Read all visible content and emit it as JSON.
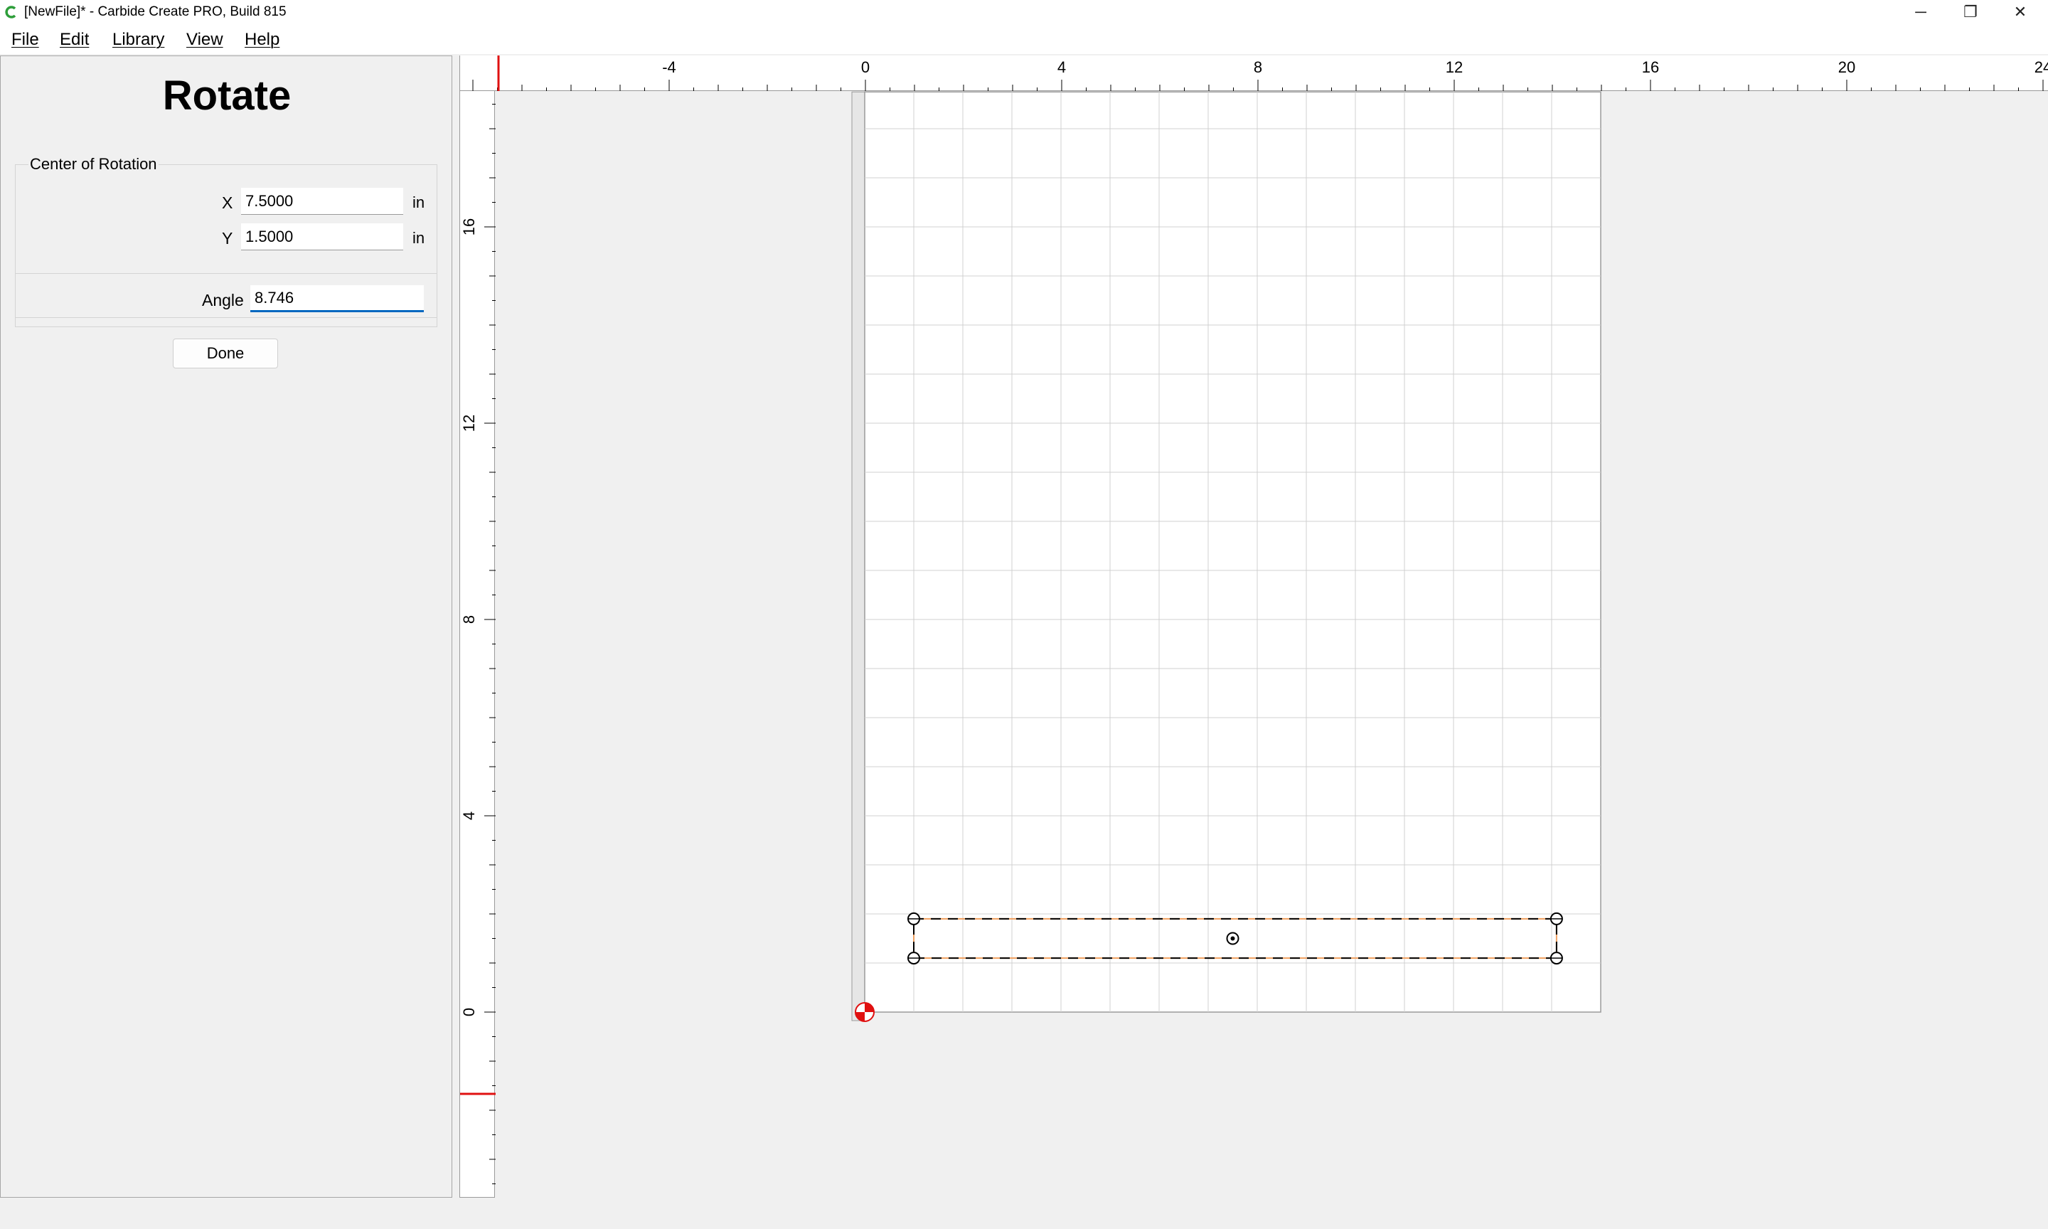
{
  "window": {
    "title": "[NewFile]* - Carbide Create PRO, Build 815",
    "icon": "carbide-c-icon",
    "controls": {
      "minimize": "─",
      "maximize": "❐",
      "close": "✕"
    }
  },
  "menu": {
    "items": [
      {
        "label": "File"
      },
      {
        "label": "Edit"
      },
      {
        "label": "Library"
      },
      {
        "label": "View"
      },
      {
        "label": "Help"
      }
    ]
  },
  "panel": {
    "title": "Rotate",
    "center_group": {
      "title": "Center of Rotation",
      "x_label": "X",
      "x_value": "7.5000",
      "x_unit": "in",
      "y_label": "Y",
      "y_value": "1.5000",
      "y_unit": "in"
    },
    "angle": {
      "label": "Angle",
      "value": "8.746"
    },
    "done_label": "Done"
  },
  "rulers": {
    "horizontal_labels": [
      "-4",
      "0",
      "4",
      "8",
      "12",
      "16",
      "20",
      "24"
    ],
    "vertical_labels": [
      "16",
      "12",
      "8",
      "4",
      "0"
    ],
    "unit": "in"
  },
  "workspace": {
    "stock_width_in": 15,
    "stock_height_in": 18.75,
    "grid_step_in": 1,
    "selection_rect": {
      "x1": 1,
      "y1": 1.1,
      "x2": 14.1,
      "y2": 1.9
    },
    "rotation_center": {
      "x": 7.5,
      "y": 1.5
    },
    "colors": {
      "grid": "#d0d0d0",
      "stock_border": "#9a9a9a",
      "selection_dash": "#f0a060",
      "origin": "#e01010",
      "ruler_marker": "#e01010"
    }
  }
}
